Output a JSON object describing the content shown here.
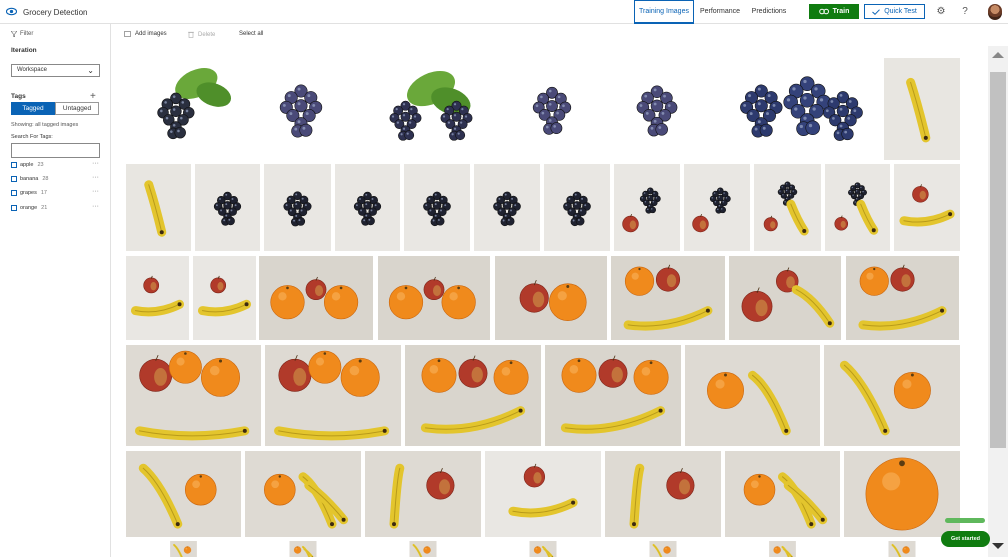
{
  "app": {
    "title": "Grocery Detection",
    "logo_icon": "eye-icon",
    "accent_color": "#0a63b5",
    "train_color": "#107c10"
  },
  "header": {
    "tabs": [
      {
        "label": "Training Images",
        "active": true
      },
      {
        "label": "Performance",
        "active": false
      },
      {
        "label": "Predictions",
        "active": false
      }
    ],
    "train_label": "Train",
    "train_icon": "gears-icon",
    "quick_test_label": "Quick Test",
    "quick_test_icon": "checkmark-icon",
    "settings_icon": "gear-icon",
    "help_icon": "question-icon",
    "avatar_icon": "user-avatar"
  },
  "sidebar": {
    "filter_label": "Filter",
    "filter_icon": "filter-icon",
    "iteration_label": "Iteration",
    "iteration_value": "Workspace",
    "tags_label": "Tags",
    "tagged_label": "Tagged",
    "untagged_label": "Untagged",
    "showing_text": "Showing: all tagged images",
    "search_tags_label": "Search For Tags:",
    "search_value": "",
    "tags": [
      {
        "name": "apple",
        "count": "23"
      },
      {
        "name": "banana",
        "count": "28"
      },
      {
        "name": "grapes",
        "count": "17"
      },
      {
        "name": "orange",
        "count": "21"
      }
    ]
  },
  "toolbar": {
    "add_images_label": "Add images",
    "delete_label": "Delete",
    "select_all_label": "Select all"
  },
  "images": {
    "rows": [
      [
        "grapes-green-leaves",
        "grapes-dark",
        "grapes-with-leaves",
        "grapes-dark",
        "grapes-dark",
        "grapes-pile",
        "banana-single"
      ],
      [
        "banana-single",
        "grapes-dark",
        "grapes-dark",
        "grapes-dark",
        "grapes-dark",
        "grapes-dark",
        "grapes-dark",
        "grapes-apple",
        "grapes-apple",
        "grapes-apple-banana",
        "grapes-apple-banana",
        "apple-banana"
      ],
      [
        "apple-banana",
        "apple-banana",
        "orange-apple-orange",
        "orange-apple-orange",
        "apple-orange",
        "orange-apple-banana",
        "apple-apple-banana",
        "orange-apple-banana"
      ],
      [
        "apple-orange-banana",
        "apple-orange-banana",
        "orange-apple-banana",
        "orange-apple-banana",
        "orange-banana",
        "banana-orange"
      ],
      [
        "banana-orange",
        "orange-banana",
        "banana-apple",
        "apple-banana",
        "banana-apple",
        "orange-banana",
        "orange-large"
      ]
    ]
  },
  "get_started": {
    "label": "Get started",
    "progress": 1.0
  }
}
